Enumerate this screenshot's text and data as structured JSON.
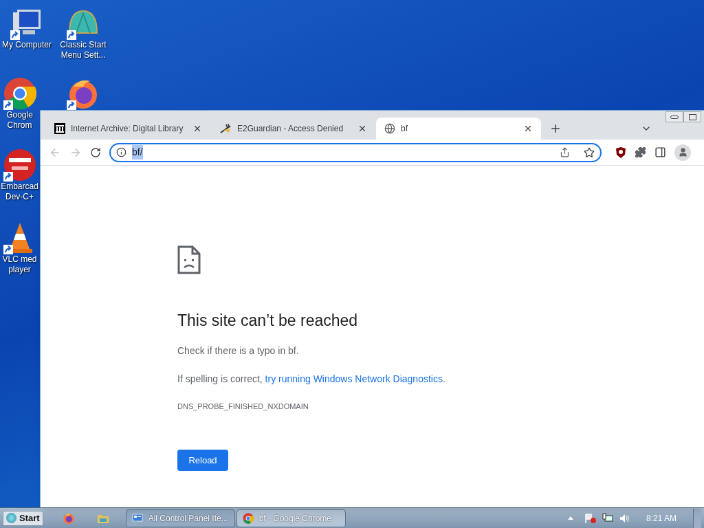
{
  "desktop_icons": [
    {
      "kind": "computer",
      "lines": [
        "My Computer"
      ]
    },
    {
      "kind": "shell",
      "lines": [
        "Classic Start",
        "Menu Sett..."
      ]
    },
    {
      "kind": "chrome",
      "lines": [
        "Google",
        "Chrom"
      ]
    },
    {
      "kind": "firefox"
    },
    {
      "kind": "dev",
      "lines": [
        "Embarcad",
        "Dev-C+"
      ]
    },
    {
      "kind": "vlc",
      "lines": [
        "VLC med",
        "player"
      ]
    }
  ],
  "browser": {
    "tabs": [
      {
        "title": "Internet Archive: Digital Library",
        "kind": "archive",
        "selected": false
      },
      {
        "title": "E2Guardian - Access Denied",
        "kind": "guardian",
        "selected": false
      },
      {
        "title": "bf",
        "kind": "globe",
        "selected": true
      }
    ],
    "address": {
      "value": "bf/",
      "highlighted": true
    },
    "page": {
      "title": "This site can’t be reached",
      "line_1": "Check if there is a typo in bf.",
      "line_2_prefix": "If spelling is correct, ",
      "line_2_link": "try running Windows Network Diagnostics",
      "line_2_suffix": ".",
      "error_code": "DNS_PROBE_FINISHED_NXDOMAIN",
      "button": "Reload"
    }
  },
  "taskbar": {
    "start": "Start",
    "windows": [
      {
        "label": "All Control Panel Ite...",
        "kind": "panel",
        "selected": false
      },
      {
        "label": "bf - Google Chrome",
        "kind": "chrome",
        "selected": true
      }
    ],
    "clock": "8:21 AM"
  }
}
